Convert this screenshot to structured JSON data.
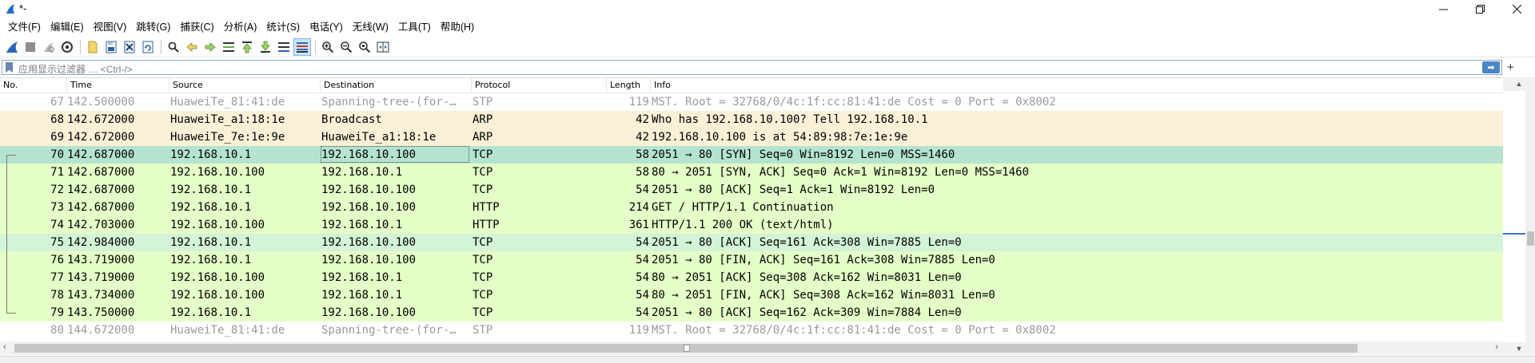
{
  "window": {
    "title": "*-"
  },
  "menu": [
    "文件(F)",
    "编辑(E)",
    "视图(V)",
    "跳转(G)",
    "捕获(C)",
    "分析(A)",
    "统计(S)",
    "电话(Y)",
    "无线(W)",
    "工具(T)",
    "帮助(H)"
  ],
  "toolbar": {
    "icons": [
      "shark-fin-start-icon",
      "stop-capture-icon",
      "restart-capture-icon",
      "capture-options-icon",
      "open-file-icon",
      "save-file-icon",
      "close-file-icon",
      "reload-file-icon",
      "find-packet-icon",
      "go-back-icon",
      "go-forward-icon",
      "go-to-packet-icon",
      "go-first-icon",
      "go-last-icon",
      "auto-scroll-icon",
      "colorize-icon",
      "zoom-in-icon",
      "zoom-out-icon",
      "zoom-normal-icon",
      "resize-columns-icon"
    ]
  },
  "filter": {
    "placeholder": "应用显示过滤器 … <Ctrl-/>",
    "apply_label": "➡",
    "add_label": "+"
  },
  "columns": {
    "no": "No.",
    "time": "Time",
    "source": "Source",
    "destination": "Destination",
    "protocol": "Protocol",
    "length": "Length",
    "info": "Info"
  },
  "colors": {
    "stp_bg": "#ffffff",
    "stp_fg": "#9a9a9a",
    "arp_bg": "#faf0d7",
    "tcp_bg": "#e4ffc7",
    "selected_bg": "#b4e4d0",
    "related_bg": "#d3f4d6",
    "text": "#000000"
  },
  "packets": [
    {
      "no": "67",
      "time": "142.500000",
      "src": "HuaweiTe_81:41:de",
      "dst": "Spanning-tree-(for-…",
      "proto": "STP",
      "len": "119",
      "info": "MST. Root = 32768/0/4c:1f:cc:81:41:de  Cost = 0  Port = 0x8002",
      "style": "stp"
    },
    {
      "no": "68",
      "time": "142.672000",
      "src": "HuaweiTe_a1:18:1e",
      "dst": "Broadcast",
      "proto": "ARP",
      "len": "42",
      "info": "Who has 192.168.10.100? Tell 192.168.10.1",
      "style": "arp"
    },
    {
      "no": "69",
      "time": "142.672000",
      "src": "HuaweiTe_7e:1e:9e",
      "dst": "HuaweiTe_a1:18:1e",
      "proto": "ARP",
      "len": "42",
      "info": "192.168.10.100 is at 54:89:98:7e:1e:9e",
      "style": "arp"
    },
    {
      "no": "70",
      "time": "142.687000",
      "src": "192.168.10.1",
      "dst": "192.168.10.100",
      "proto": "TCP",
      "len": "58",
      "info": "2051 → 80 [SYN] Seq=0 Win=8192 Len=0 MSS=1460",
      "style": "selected"
    },
    {
      "no": "71",
      "time": "142.687000",
      "src": "192.168.10.100",
      "dst": "192.168.10.1",
      "proto": "TCP",
      "len": "58",
      "info": "80 → 2051 [SYN, ACK] Seq=0 Ack=1 Win=8192 Len=0 MSS=1460",
      "style": "tcp"
    },
    {
      "no": "72",
      "time": "142.687000",
      "src": "192.168.10.1",
      "dst": "192.168.10.100",
      "proto": "TCP",
      "len": "54",
      "info": "2051 → 80 [ACK] Seq=1 Ack=1 Win=8192 Len=0",
      "style": "tcp"
    },
    {
      "no": "73",
      "time": "142.687000",
      "src": "192.168.10.1",
      "dst": "192.168.10.100",
      "proto": "HTTP",
      "len": "214",
      "info": "GET / HTTP/1.1 Continuation",
      "style": "tcp"
    },
    {
      "no": "74",
      "time": "142.703000",
      "src": "192.168.10.100",
      "dst": "192.168.10.1",
      "proto": "HTTP",
      "len": "361",
      "info": "HTTP/1.1 200 OK  (text/html)",
      "style": "tcp"
    },
    {
      "no": "75",
      "time": "142.984000",
      "src": "192.168.10.1",
      "dst": "192.168.10.100",
      "proto": "TCP",
      "len": "54",
      "info": "2051 → 80 [ACK] Seq=161 Ack=308 Win=7885 Len=0",
      "style": "related"
    },
    {
      "no": "76",
      "time": "143.719000",
      "src": "192.168.10.1",
      "dst": "192.168.10.100",
      "proto": "TCP",
      "len": "54",
      "info": "2051 → 80 [FIN, ACK] Seq=161 Ack=308 Win=7885 Len=0",
      "style": "tcp"
    },
    {
      "no": "77",
      "time": "143.719000",
      "src": "192.168.10.100",
      "dst": "192.168.10.1",
      "proto": "TCP",
      "len": "54",
      "info": "80 → 2051 [ACK] Seq=308 Ack=162 Win=8031 Len=0",
      "style": "tcp"
    },
    {
      "no": "78",
      "time": "143.734000",
      "src": "192.168.10.100",
      "dst": "192.168.10.1",
      "proto": "TCP",
      "len": "54",
      "info": "80 → 2051 [FIN, ACK] Seq=308 Ack=162 Win=8031 Len=0",
      "style": "tcp"
    },
    {
      "no": "79",
      "time": "143.750000",
      "src": "192.168.10.1",
      "dst": "192.168.10.100",
      "proto": "TCP",
      "len": "54",
      "info": "2051 → 80 [ACK] Seq=162 Ack=309 Win=7884 Len=0",
      "style": "tcp"
    },
    {
      "no": "80",
      "time": "144.672000",
      "src": "HuaweiTe_81:41:de",
      "dst": "Spanning-tree-(for-…",
      "proto": "STP",
      "len": "119",
      "info": "MST. Root = 32768/0/4c:1f:cc:81:41:de  Cost = 0  Port = 0x8002",
      "style": "stp"
    }
  ],
  "selected_packet": "70"
}
